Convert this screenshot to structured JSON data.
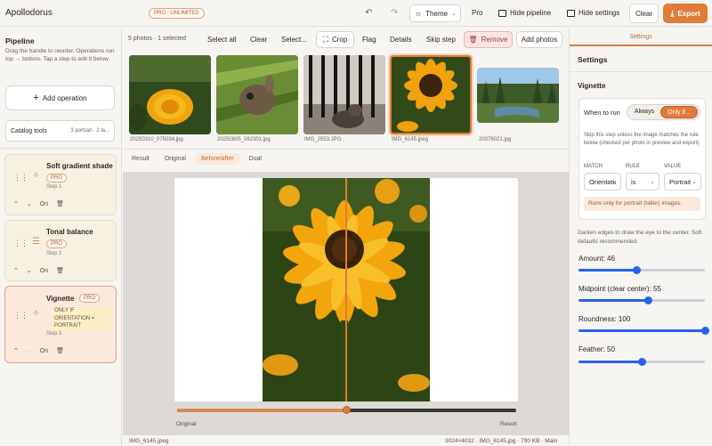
{
  "app": {
    "title": "Apollodorus",
    "plan_badge": "PRO · UNLIMITED"
  },
  "toolbar": {
    "theme_label": "Theme",
    "pro_label": "Pro",
    "hide_pipeline": "Hide pipeline",
    "hide_settings": "Hide settings",
    "clear": "Clear",
    "export": "Export"
  },
  "pipeline": {
    "title": "Pipeline",
    "description": "Drag the handle to reorder. Operations run top → bottom. Tap a step to edit it below.",
    "add_operation": "Add operation",
    "catalog_tools": "Catalog tools",
    "catalog_info": "3 portrait · 2 la...",
    "steps": [
      {
        "title": "Soft gradient shade",
        "badge": "PRO",
        "step": "Step 1",
        "toggle": "On"
      },
      {
        "title": "Tonal balance",
        "badge": "PRO",
        "step": "Step 2",
        "toggle": "On"
      },
      {
        "title": "Vignette",
        "badge": "PRO",
        "condition": "ONLY IF ORIENTATION = PORTRAIT",
        "step": "Step 3",
        "toggle": "On"
      }
    ]
  },
  "photos": {
    "count": "5 photos · 1 selected",
    "select_all": "Select all",
    "clear": "Clear",
    "select_menu": "Select...",
    "crop": "Crop",
    "flag": "Flag",
    "details": "Details",
    "skip_step": "Skip step",
    "remove": "Remove",
    "add_photos": "Add photos",
    "thumbnails": [
      {
        "name": "20250310_075034.jpg"
      },
      {
        "name": "20250805_082301.jpg"
      },
      {
        "name": "IMG_2553.JPG"
      },
      {
        "name": "IMG_6145.jpeg"
      },
      {
        "name": "20378021.jpg"
      }
    ]
  },
  "preview": {
    "tabs": [
      "Result",
      "Original",
      "Before/after",
      "Dual"
    ],
    "active_tab": "Before/after",
    "left_label": "Original",
    "right_label": "Result",
    "compare_position": 0.5,
    "footer_name": "IMG_6145.jpeg",
    "footer_info": "3024×4032 · IMG_6145.jpg · 790 KB · Main"
  },
  "settings": {
    "tab": "Settings",
    "title": "Settings",
    "section": "Vignette",
    "when_to_run": "When to run",
    "always": "Always",
    "only_if": "Only if...",
    "rule_help": "Skip this step unless the image matches the rule below (checked per photo in preview and export).",
    "match_label": "MATCH",
    "rule_label": "RULE",
    "value_label": "VALUE",
    "match_value": "Orientation",
    "rule_value": "is",
    "value_value": "Portrait",
    "rule_note": "Runs only for portrait (taller) images.",
    "description": "Darken edges to draw the eye to the center. Soft defaults recommended.",
    "amount": {
      "label": "Amount: 46",
      "value": 46,
      "max": 100
    },
    "midpoint": {
      "label": "Midpoint (clear center): 55",
      "value": 55,
      "max": 100
    },
    "roundness": {
      "label": "Roundness: 100",
      "value": 100,
      "max": 100
    },
    "feather": {
      "label": "Feather: 50",
      "value": 50,
      "max": 100
    }
  },
  "colors": {
    "accent": "#e07b3a",
    "slider": "#2563eb",
    "danger": "#c0392b"
  }
}
